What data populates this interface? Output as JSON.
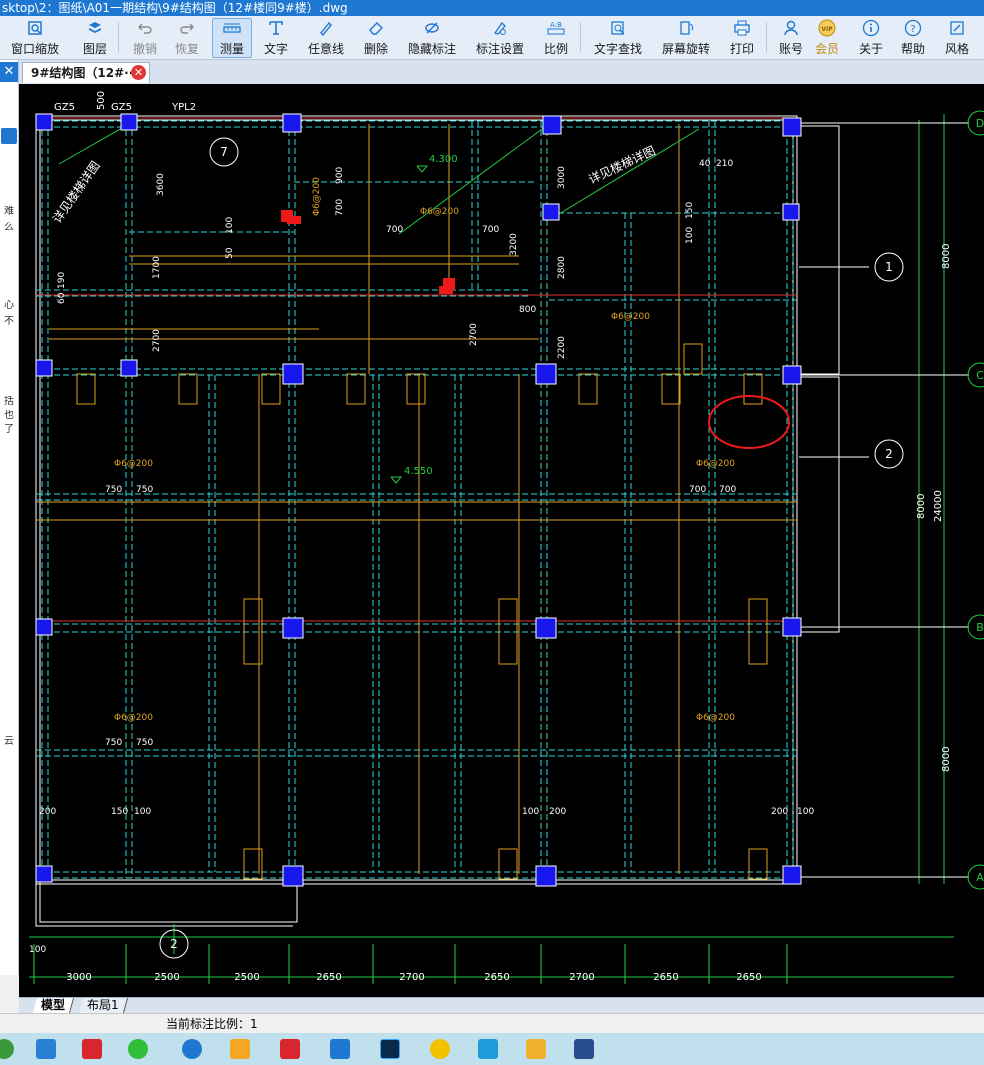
{
  "window": {
    "title": "sktop\\2：图纸\\A01一期结构\\9#结构图（12#楼同9#楼）.dwg"
  },
  "toolbar": {
    "items": [
      {
        "label": "窗口缩放",
        "icon": "zoom-window-icon"
      },
      {
        "label": "图层",
        "icon": "layers-icon"
      },
      {
        "label": "撤销",
        "icon": "undo-icon"
      },
      {
        "label": "恢复",
        "icon": "redo-icon"
      },
      {
        "label": "测量",
        "icon": "measure-icon"
      },
      {
        "label": "文字",
        "icon": "text-icon"
      },
      {
        "label": "任意线",
        "icon": "freehand-line-icon"
      },
      {
        "label": "删除",
        "icon": "eraser-icon"
      },
      {
        "label": "隐藏标注",
        "icon": "hide-annotation-icon"
      },
      {
        "label": "标注设置",
        "icon": "annotation-settings-icon"
      },
      {
        "label": "比例",
        "icon": "scale-icon"
      },
      {
        "label": "文字查找",
        "icon": "text-search-icon"
      },
      {
        "label": "屏幕旋转",
        "icon": "rotate-screen-icon"
      },
      {
        "label": "打印",
        "icon": "print-icon"
      },
      {
        "label": "账号",
        "icon": "account-icon"
      },
      {
        "label": "会员",
        "icon": "vip-icon"
      },
      {
        "label": "关于",
        "icon": "about-icon"
      },
      {
        "label": "帮助",
        "icon": "help-icon"
      },
      {
        "label": "风格",
        "icon": "style-icon"
      }
    ],
    "scale_icon_text": "A:B"
  },
  "tabs": {
    "document_tab_label": "9#结构图（12#···",
    "close_glyph": "✕",
    "model_tab": "模型",
    "layout_tab": "布局1"
  },
  "left_panel": {
    "close_glyph": "✕",
    "chars": [
      "难",
      "么",
      "心",
      "不",
      "括",
      "也",
      "了",
      "云"
    ]
  },
  "status": {
    "scale_text": "当前标注比例：1"
  },
  "drawing": {
    "column_labels_top": [
      "GZ5",
      "GZ5",
      "YPL2"
    ],
    "top_dims": [
      "500"
    ],
    "stair_note": "详见楼梯详图",
    "axis_bubbles_right": [
      "D",
      "C",
      "B",
      "A"
    ],
    "section_bubbles": [
      "1",
      "2"
    ],
    "bottom_section_bubble": "2",
    "section_bubble_top": "7",
    "bottom_dims": [
      "3000",
      "2500",
      "2500",
      "2650",
      "2700",
      "2650",
      "2700",
      "2650",
      "2650"
    ],
    "right_dims": [
      "8000",
      "8000",
      "8000",
      "24000"
    ],
    "rebar_notes": [
      "Φ6@200",
      "Φ6@200",
      "Φ6@200",
      "Φ6@200",
      "Φ6@200",
      "Φ6@200",
      "Φ6@200"
    ],
    "elev_marks": [
      "4.300",
      "4.550"
    ],
    "small_dims": [
      "700",
      "700",
      "750",
      "750",
      "700",
      "700",
      "750",
      "750",
      "200",
      "150",
      "100",
      "100",
      "200",
      "200",
      "100",
      "100",
      "1700",
      "2700",
      "3600",
      "2700",
      "3200",
      "2800",
      "2200",
      "3000",
      "800",
      "900",
      "700",
      "40",
      "210",
      "150",
      "100",
      "60",
      "190",
      "50",
      "100"
    ]
  },
  "taskbar": {
    "icons": [
      "browser-icon",
      "photos-icon",
      "app-red-icon",
      "wechat-icon",
      "s-browser-icon",
      "cloud-icon",
      "pdf-icon",
      "snip-icon",
      "photoshop-icon",
      "music-icon",
      "tencent-icon",
      "folder-icon",
      "cad-icon"
    ]
  }
}
